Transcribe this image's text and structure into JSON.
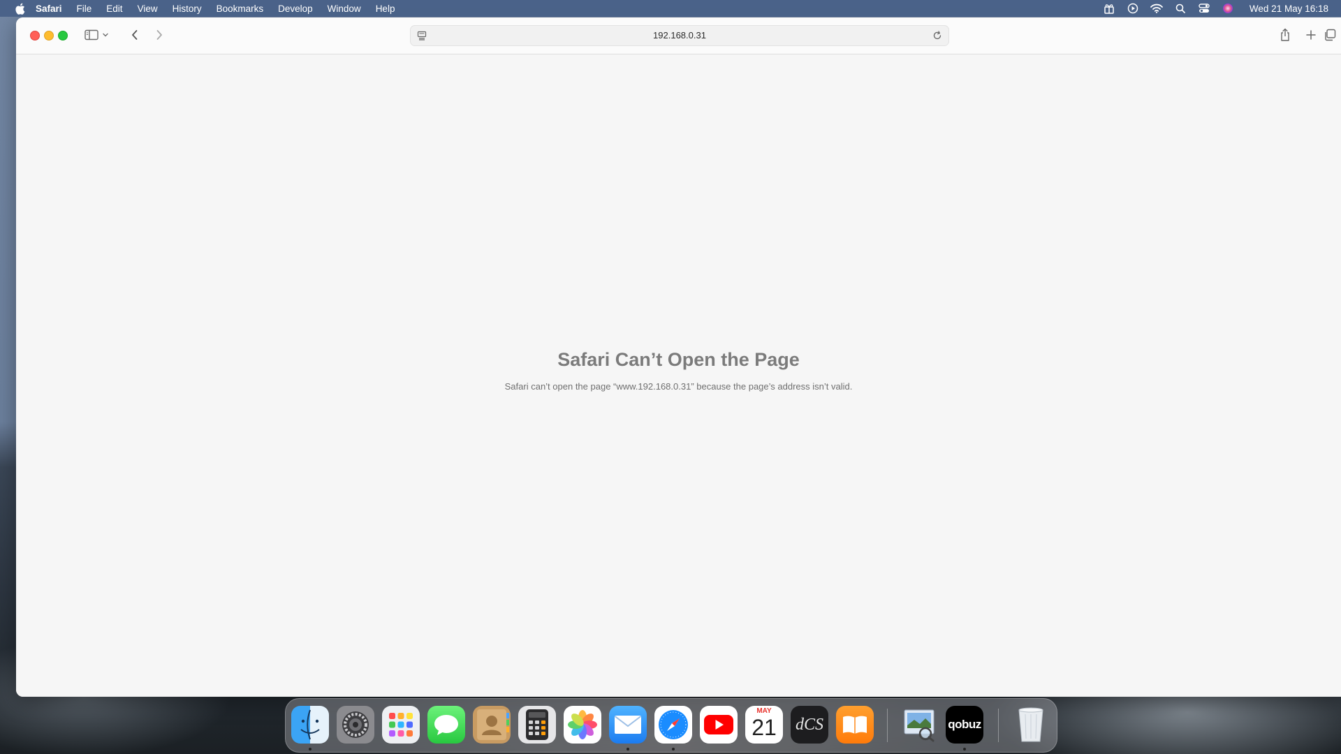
{
  "menubar": {
    "app_name": "Safari",
    "items": [
      "File",
      "Edit",
      "View",
      "History",
      "Bookmarks",
      "Develop",
      "Window",
      "Help"
    ],
    "clock": "Wed 21 May  16:18"
  },
  "toolbar": {
    "url": "192.168.0.31"
  },
  "page": {
    "error_title": "Safari Can’t Open the Page",
    "error_message": "Safari can’t open the page “www.192.168.0.31” because the page’s address isn’t valid."
  },
  "dock": {
    "calendar_month": "MAY",
    "calendar_day": "21",
    "dcs_label": "dCS",
    "qobuz_label": "qobuz",
    "apps": [
      "Finder",
      "System Settings",
      "Launchpad",
      "Messages",
      "Contacts",
      "Calculator",
      "Photos",
      "Mail",
      "Safari",
      "YouTube",
      "Calendar",
      "dCS",
      "Books",
      "Preview",
      "Qobuz",
      "Trash"
    ]
  },
  "colors": {
    "menubar": "#465f87",
    "close": "#ff5f57",
    "minimize": "#febc2e",
    "maximize": "#28c840",
    "error_title": "#7b7b7b"
  }
}
